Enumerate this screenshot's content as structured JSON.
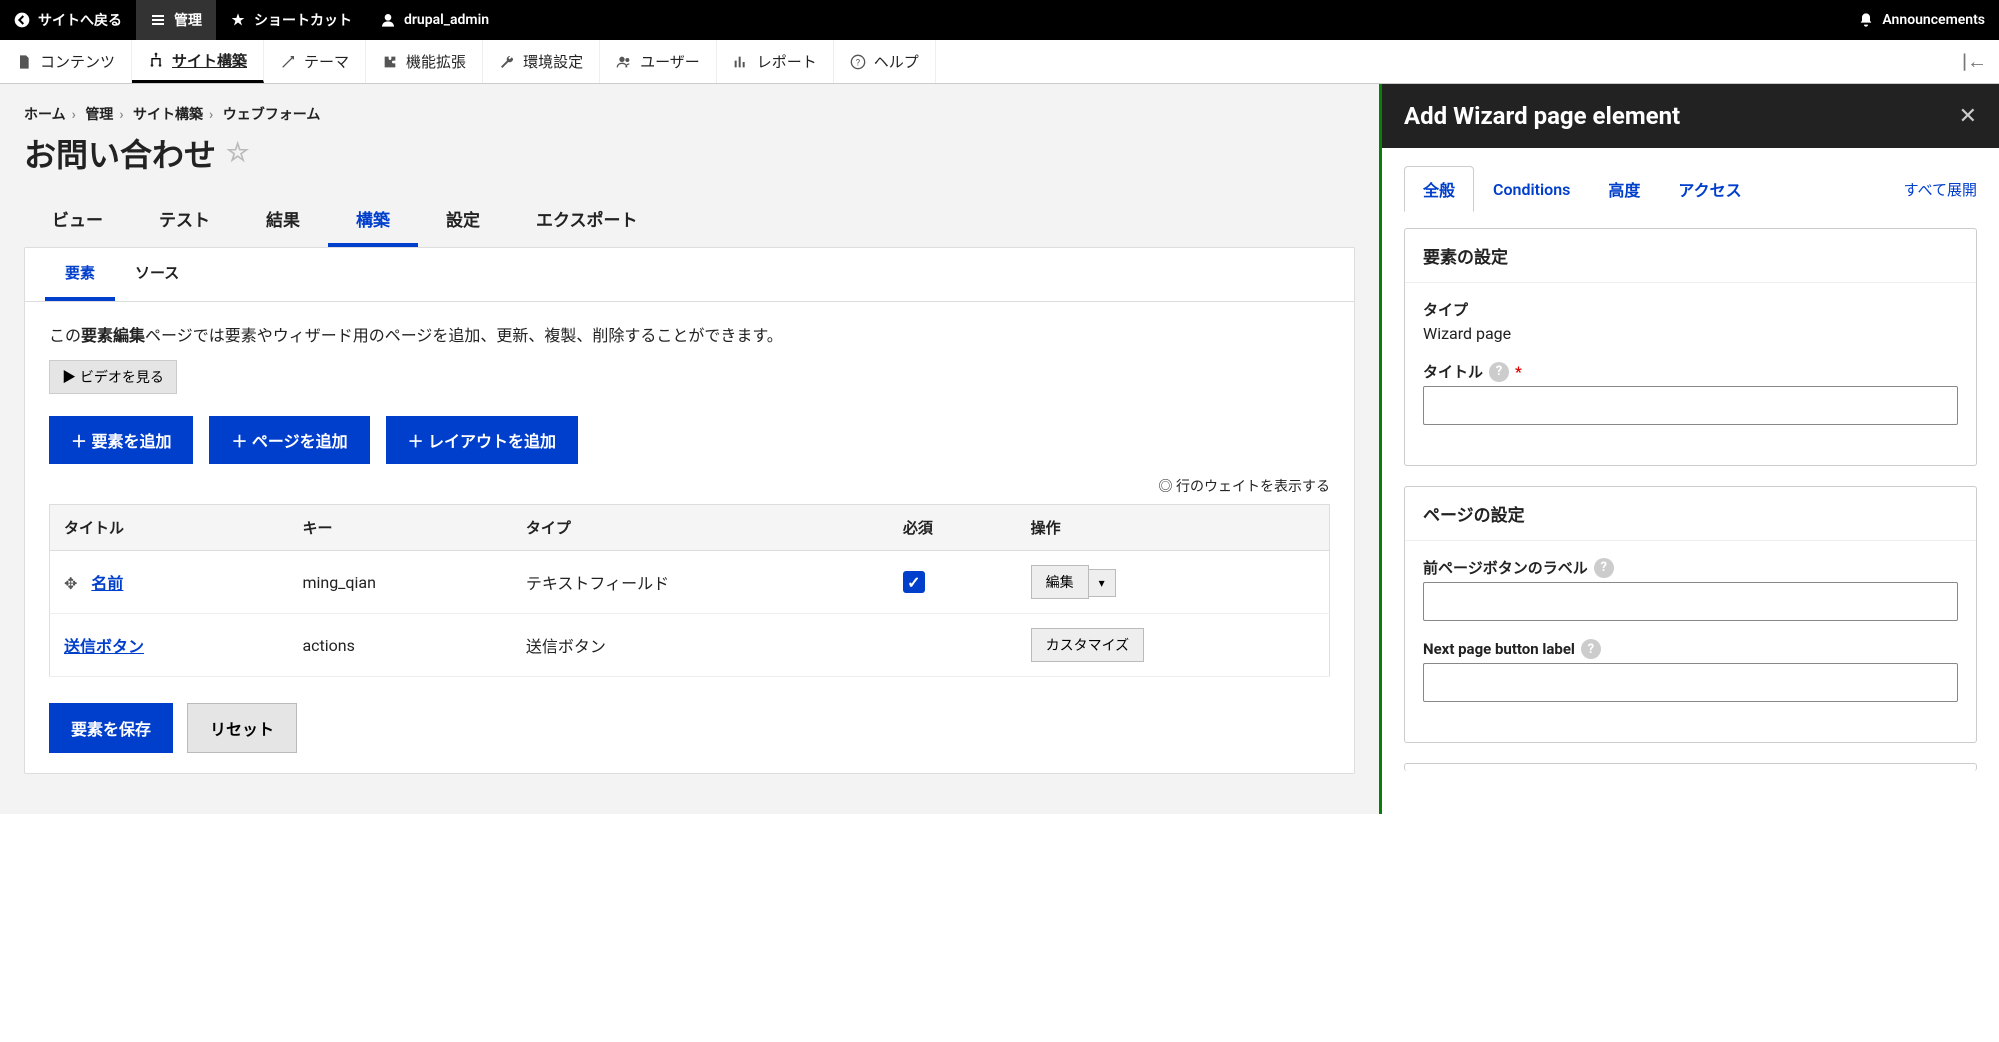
{
  "topbar": {
    "back": "サイトへ戻る",
    "manage": "管理",
    "shortcuts": "ショートカット",
    "user": "drupal_admin",
    "announcements": "Announcements"
  },
  "adminbar": {
    "content": "コンテンツ",
    "structure": "サイト構築",
    "appearance": "テーマ",
    "extend": "機能拡張",
    "config": "環境設定",
    "people": "ユーザー",
    "reports": "レポート",
    "help": "ヘルプ"
  },
  "breadcrumbs": [
    "ホーム",
    "管理",
    "サイト構築",
    "ウェブフォーム"
  ],
  "page_title": "お問い合わせ",
  "view_tabs": {
    "view": "ビュー",
    "test": "テスト",
    "results": "結果",
    "build": "構築",
    "settings": "設定",
    "export": "エクスポート"
  },
  "sub_tabs": {
    "elements": "要素",
    "source": "ソース"
  },
  "desc_pre": "この",
  "desc_bold": "要素編集",
  "desc_post": "ページでは要素やウィザード用のページを追加、更新、複製、削除することができます。",
  "video_btn": "▶ ビデオを見る",
  "btn_add_element": "＋ 要素を追加",
  "btn_add_page": "＋ ページを追加",
  "btn_add_layout": "＋ レイアウトを追加",
  "weight_toggle": "行のウェイトを表示する",
  "table": {
    "headers": {
      "title": "タイトル",
      "key": "キー",
      "type": "タイプ",
      "required": "必須",
      "ops": "操作"
    },
    "rows": [
      {
        "title": "名前",
        "key": "ming_qian",
        "type": "テキストフィールド",
        "required": true,
        "op": "編集",
        "draggable": true
      },
      {
        "title": "送信ボタン",
        "key": "actions",
        "type": "送信ボタン",
        "required": false,
        "op": "カスタマイズ",
        "draggable": false
      }
    ]
  },
  "btn_save": "要素を保存",
  "btn_reset": "リセット",
  "panel": {
    "title": "Add Wizard page element",
    "tabs": {
      "general": "全般",
      "conditions": "Conditions",
      "advanced": "高度",
      "access": "アクセス"
    },
    "expand_all": "すべて展開",
    "fs1": {
      "legend": "要素の設定",
      "type_label": "タイプ",
      "type_value": "Wizard page",
      "title_label": "タイトル"
    },
    "fs2": {
      "legend": "ページの設定",
      "prev_label": "前ページボタンのラベル",
      "next_label": "Next page button label"
    }
  }
}
